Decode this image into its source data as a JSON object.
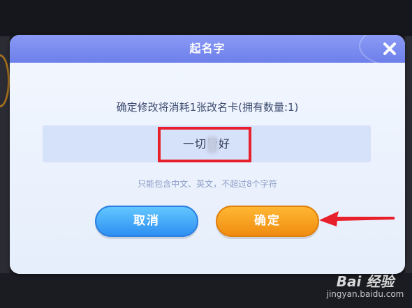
{
  "dialog": {
    "title": "起名字",
    "close_icon": "close-icon",
    "message": "确定修改将消耗1张改名卡(拥有数量:1)",
    "name_input": {
      "value": "一切皆好"
    },
    "hint": "只能包含中文、英文，不超过8个字符",
    "cancel_label": "取消",
    "confirm_label": "确定"
  },
  "annotations": {
    "highlight_color": "#e8202b",
    "arrow_icon": "red-arrow-icon"
  },
  "colors": {
    "title_bar": "#7686ef",
    "cancel_button": "#2f8ff2",
    "confirm_button": "#f08c10",
    "dialog_body": "#e9f0fd"
  },
  "watermark": {
    "logo": "Bai 经验",
    "url": "jingyan.baidu.com"
  }
}
